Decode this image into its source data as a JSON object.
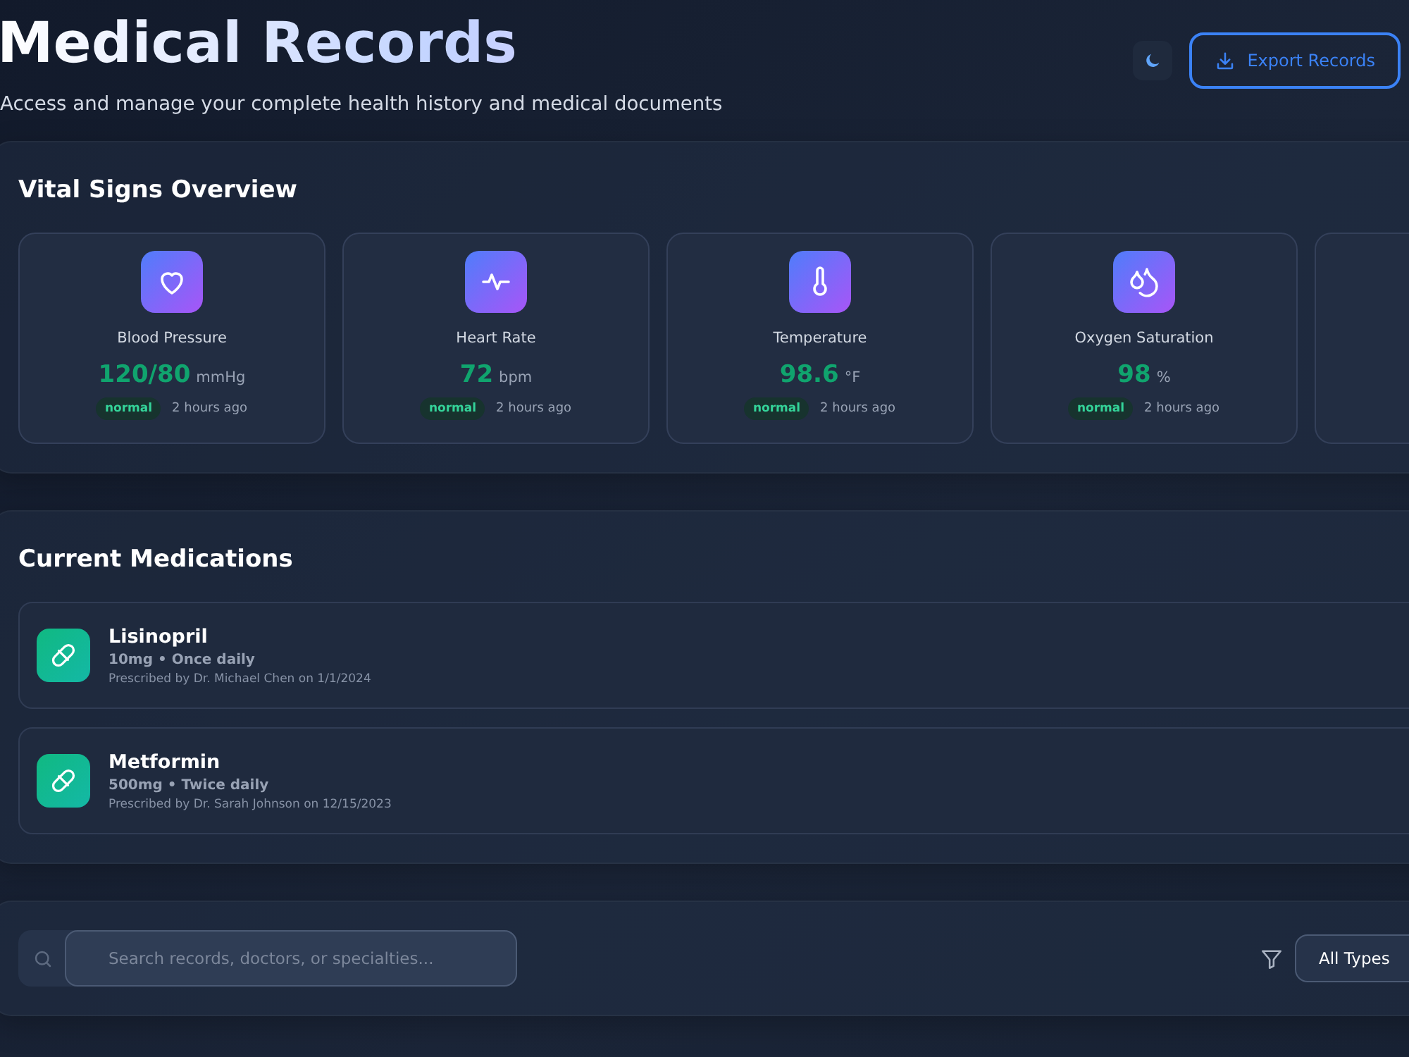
{
  "header": {
    "title": "Medical Records",
    "subtitle": "Access and manage your complete health history and medical documents",
    "export_button": "Export Records"
  },
  "vitals": {
    "title": "Vital Signs Overview",
    "items": [
      {
        "kind": "heart",
        "name": "Blood Pressure",
        "value": "120/80",
        "unit": "mmHg",
        "status": "normal",
        "time": "2 hours ago"
      },
      {
        "kind": "pulse",
        "name": "Heart Rate",
        "value": "72",
        "unit": "bpm",
        "status": "normal",
        "time": "2 hours ago"
      },
      {
        "kind": "thermometer",
        "name": "Temperature",
        "value": "98.6",
        "unit": "°F",
        "status": "normal",
        "time": "2 hours ago"
      },
      {
        "kind": "drops",
        "name": "Oxygen Saturation",
        "value": "98",
        "unit": "%",
        "status": "normal",
        "time": "2 hours ago"
      },
      {
        "kind": "empty"
      }
    ]
  },
  "medications": {
    "title": "Current Medications",
    "items": [
      {
        "name": "Lisinopril",
        "dose": "10mg • Once daily",
        "prescribed": "Prescribed by Dr. Michael Chen on 1/1/2024"
      },
      {
        "name": "Metformin",
        "dose": "500mg • Twice daily",
        "prescribed": "Prescribed by Dr. Sarah Johnson on 12/15/2023"
      }
    ]
  },
  "filters": {
    "search_placeholder": "Search records, doctors, or specialties...",
    "type_select": "All Types"
  }
}
